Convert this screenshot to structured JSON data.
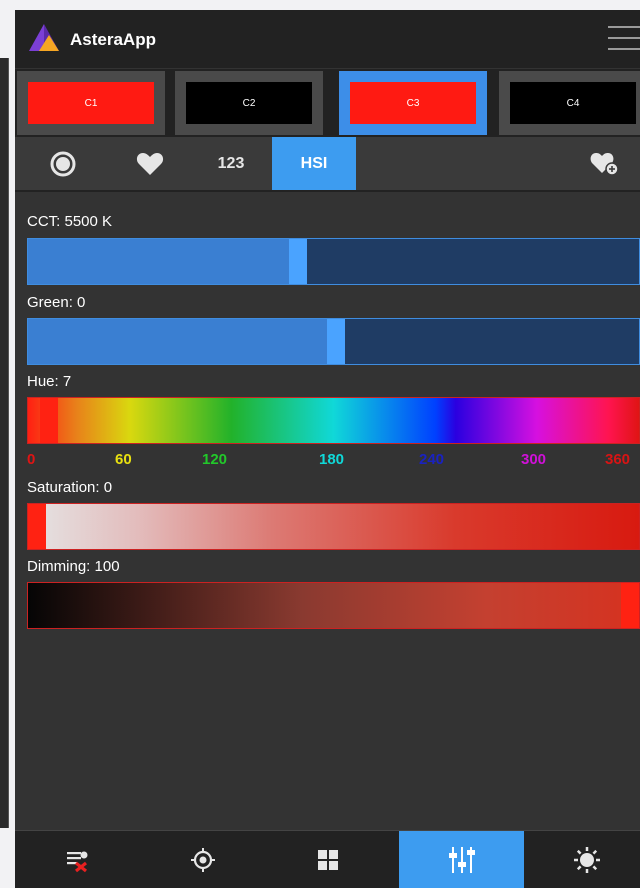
{
  "app": {
    "title": "AsteraApp"
  },
  "cues": [
    {
      "label": "C1",
      "color": "#ff1a12",
      "selected": false
    },
    {
      "label": "C2",
      "color": "#000000",
      "selected": false
    },
    {
      "label": "C3",
      "color": "#ff1a12",
      "selected": true
    },
    {
      "label": "C4",
      "color": "#000000",
      "selected": false
    }
  ],
  "tabs": {
    "color_wheel": "color-wheel-icon",
    "favorites": "heart-icon",
    "numeric": "123",
    "hsi": "HSI",
    "add_favorite": "heart-plus-icon",
    "active": "HSI"
  },
  "sliders": {
    "cct": {
      "label": "CCT: 5500 K",
      "value": 5500
    },
    "green": {
      "label": "Green: 0",
      "value": 0
    },
    "hue": {
      "label": "Hue: 7",
      "value": 7,
      "scale": [
        "0",
        "60",
        "120",
        "180",
        "240",
        "300",
        "360"
      ]
    },
    "saturation": {
      "label": "Saturation: 0",
      "value": 0
    },
    "dimming": {
      "label": "Dimming: 100",
      "value": 100
    }
  },
  "bottom_nav": [
    {
      "icon": "fixture-list-remove-icon",
      "active": false
    },
    {
      "icon": "locate-icon",
      "active": false
    },
    {
      "icon": "grid-icon",
      "active": false
    },
    {
      "icon": "mixer-sliders-icon",
      "active": true
    },
    {
      "icon": "settings-sun-icon",
      "active": false
    }
  ],
  "colors": {
    "accent_blue": "#3d9cf0",
    "cue_red": "#ff1a12",
    "header": "#222222",
    "background": "#333333"
  }
}
